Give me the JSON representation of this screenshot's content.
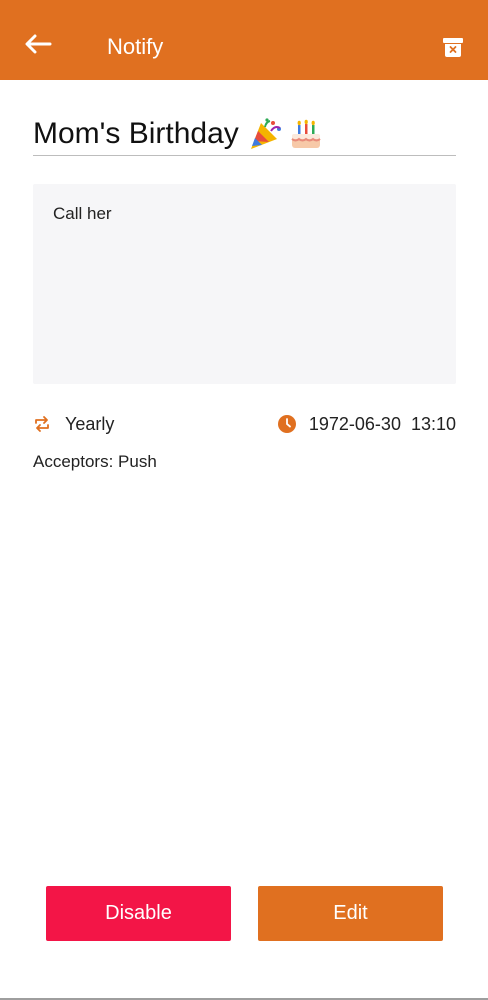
{
  "appbar": {
    "title": "Notify",
    "back_icon": "arrow-left-icon",
    "delete_icon": "delete-box-icon"
  },
  "reminder": {
    "title": "Mom's Birthday",
    "emoji_icons": [
      "party-popper-icon",
      "birthday-cake-icon"
    ],
    "note": "Call her",
    "repeat_icon": "repeat-icon",
    "repeat": "Yearly",
    "clock_icon": "clock-icon",
    "datetime": "1972-06-30  13:10",
    "acceptors": "Acceptors: Push"
  },
  "actions": {
    "disable_label": "Disable",
    "edit_label": "Edit"
  },
  "colors": {
    "accent": "#E07020",
    "danger": "#F31547",
    "note_background": "#F6F6F8"
  }
}
